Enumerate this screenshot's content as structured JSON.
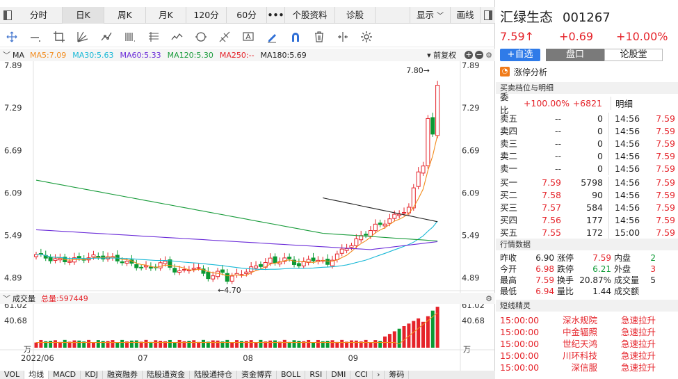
{
  "tabs": [
    "分时",
    "日K",
    "周K",
    "月K",
    "120分",
    "60分",
    "•••",
    "个股资料",
    "诊股",
    "显示",
    "画线"
  ],
  "tab_active": "日K",
  "ma_bar": {
    "label": "MA",
    "items": [
      {
        "text": "MA5:7.09",
        "color": "#f28b1c"
      },
      {
        "text": "MA30:5.63",
        "color": "#18b8d6"
      },
      {
        "text": "MA60:5.33",
        "color": "#6a2bd8"
      },
      {
        "text": "MA120:5.30",
        "color": "#1a9c3c"
      },
      {
        "text": "MA250:--",
        "color": "#e5232a"
      },
      {
        "text": "MA180:5.69",
        "color": "#222222"
      }
    ],
    "adjust": "前复权"
  },
  "vol_bar": {
    "label": "成交量",
    "total": "总量:597449"
  },
  "chart_data": {
    "type": "candlestick",
    "price_ticks": [
      "7.89",
      "7.29",
      "6.69",
      "6.09",
      "5.49",
      "4.89"
    ],
    "price_range": [
      4.69,
      7.89
    ],
    "max_label": "7.80",
    "min_label": "4.70",
    "vol_ticks": [
      "61.02",
      "40.68"
    ],
    "vol_unit": "万",
    "x_labels": [
      "2022/06",
      "07",
      "08",
      "09"
    ],
    "x_label_index": [
      0,
      22,
      44,
      66
    ]
  },
  "bottom_tabs": [
    "VOL",
    "均线",
    "MACD",
    "KDJ",
    "融资融券",
    "陆股通资金",
    "陆股通持仓",
    "资金博弈",
    "BOLL",
    "RSI",
    "DMI",
    "CCI",
    "›",
    "筹码"
  ],
  "stock": {
    "name": "汇绿生态",
    "code": "001267",
    "price": "7.59",
    "arrow": "↑",
    "change": "+0.69",
    "pct": "+10.00%",
    "add_btn": "+自选",
    "tab1": "盘口",
    "tab2": "论股堂",
    "limit_label": "涨停分析"
  },
  "orderbook": {
    "title": "买卖档位与明细",
    "ratio_label": "委比",
    "ratio": "+100.00%",
    "diff": "+6821",
    "detail_label": "明细",
    "asks": [
      {
        "label": "卖五",
        "price": "--",
        "vol": "0"
      },
      {
        "label": "卖四",
        "price": "--",
        "vol": "0"
      },
      {
        "label": "卖三",
        "price": "--",
        "vol": "0"
      },
      {
        "label": "卖二",
        "price": "--",
        "vol": "0"
      },
      {
        "label": "卖一",
        "price": "--",
        "vol": "0"
      }
    ],
    "bids": [
      {
        "label": "买一",
        "price": "7.59",
        "vol": "5798"
      },
      {
        "label": "买二",
        "price": "7.58",
        "vol": "90"
      },
      {
        "label": "买三",
        "price": "7.57",
        "vol": "584"
      },
      {
        "label": "买四",
        "price": "7.56",
        "vol": "177"
      },
      {
        "label": "买五",
        "price": "7.55",
        "vol": "172"
      }
    ],
    "ticks": [
      {
        "time": "14:56",
        "price": "7.59"
      },
      {
        "time": "14:56",
        "price": "7.59"
      },
      {
        "time": "14:56",
        "price": "7.59"
      },
      {
        "time": "14:56",
        "price": "7.59"
      },
      {
        "time": "14:56",
        "price": "7.59"
      },
      {
        "time": "14:56",
        "price": "7.59"
      },
      {
        "time": "14:56",
        "price": "7.59"
      },
      {
        "time": "14:56",
        "price": "7.59"
      },
      {
        "time": "14:56",
        "price": "7.59"
      },
      {
        "time": "15:00",
        "price": "7.59"
      }
    ]
  },
  "quote": {
    "title": "行情数据",
    "rows": [
      [
        {
          "k": "昨收",
          "v": "6.90",
          "c": ""
        },
        {
          "k": "涨停",
          "v": "7.59",
          "c": "red"
        },
        {
          "k": "内盘",
          "v": "2",
          "c": "green"
        }
      ],
      [
        {
          "k": "今开",
          "v": "6.98",
          "c": "red"
        },
        {
          "k": "跌停",
          "v": "6.21",
          "c": "green"
        },
        {
          "k": "外盘",
          "v": "3",
          "c": "red"
        }
      ],
      [
        {
          "k": "最高",
          "v": "7.59",
          "c": "red"
        },
        {
          "k": "换手",
          "v": "20.87%",
          "c": ""
        },
        {
          "k": "成交量",
          "v": "5",
          "c": ""
        }
      ],
      [
        {
          "k": "最低",
          "v": "6.94",
          "c": "red"
        },
        {
          "k": "量比",
          "v": "1.44",
          "c": ""
        },
        {
          "k": "成交额",
          "v": "",
          "c": ""
        }
      ]
    ]
  },
  "short": {
    "title": "短线精灵",
    "rows": [
      {
        "time": "15:00:00",
        "name": "深水规院",
        "event": "急速拉升"
      },
      {
        "time": "15:00:00",
        "name": "中金辐照",
        "event": "急速拉升"
      },
      {
        "time": "15:00:00",
        "name": "世纪天鸿",
        "event": "急速拉升"
      },
      {
        "time": "15:00:00",
        "name": "川环科技",
        "event": "急速拉升"
      },
      {
        "time": "15:00:00",
        "name": "深信服",
        "event": "急速拉升"
      }
    ]
  }
}
